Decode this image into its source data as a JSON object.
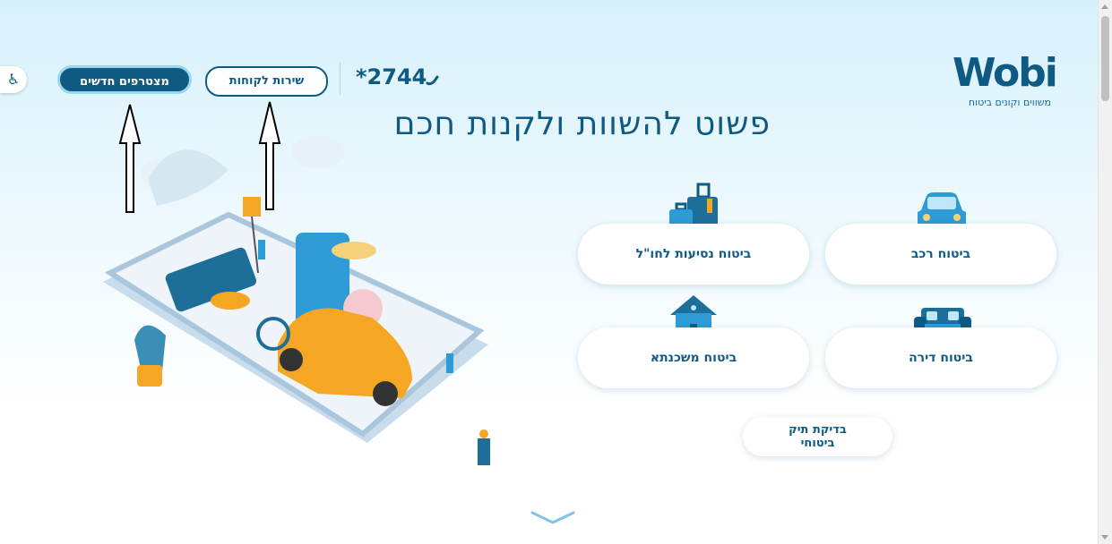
{
  "header": {
    "logo_word": "Wobi",
    "logo_tagline": "משווים וקונים ביטוח",
    "phone": "*2744",
    "customer_service_label": "שירות לקוחות",
    "new_members_label": "מצטרפים חדשים",
    "accessibility_icon": "♿"
  },
  "hero": {
    "headline": "פשוט להשוות ולקנות חכם"
  },
  "products": [
    {
      "label": "ביטוח רכב",
      "icon": "car-icon"
    },
    {
      "label": "ביטוח נסיעות לחו\"ל",
      "icon": "luggage-icon"
    },
    {
      "label": "ביטוח דירה",
      "icon": "sofa-icon"
    },
    {
      "label": "ביטוח משכנתא",
      "icon": "house-icon"
    }
  ],
  "portfolio_check": {
    "line1": "בדיקת תיק",
    "line2": "ביטוחי"
  },
  "colors": {
    "brand": "#0f5a83",
    "accent": "#9bd8f0",
    "background": "#d6f0fb"
  }
}
